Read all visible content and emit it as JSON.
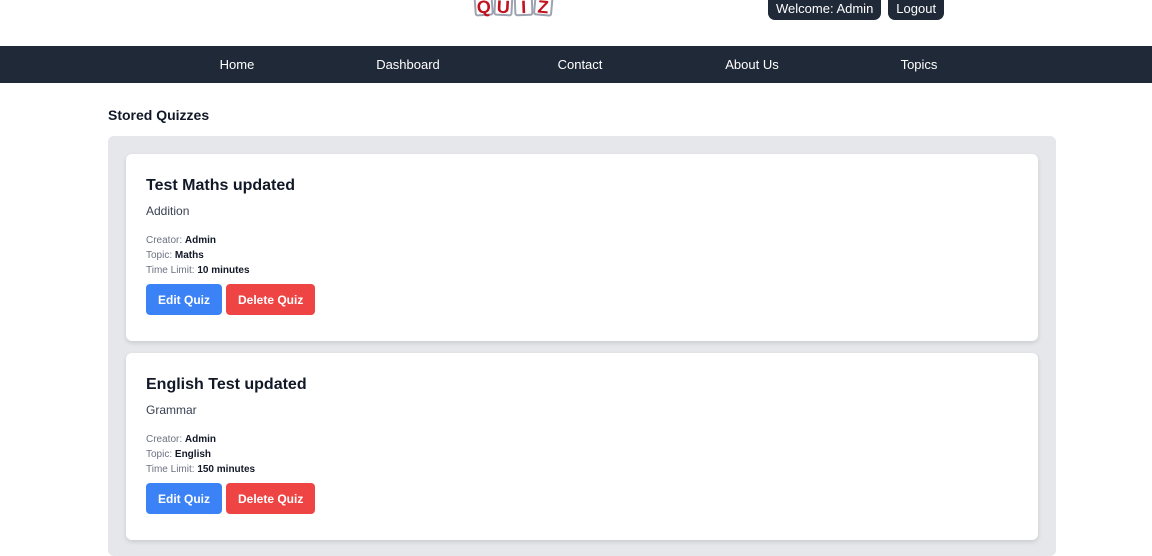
{
  "header": {
    "logo_letters": [
      "Q",
      "U",
      "I",
      "Z"
    ],
    "welcome": "Welcome: Admin",
    "logout_label": "Logout"
  },
  "nav": {
    "items": [
      {
        "label": "Home"
      },
      {
        "label": "Dashboard"
      },
      {
        "label": "Contact"
      },
      {
        "label": "About Us"
      },
      {
        "label": "Topics"
      }
    ]
  },
  "main": {
    "title": "Stored Quizzes",
    "quizzes": [
      {
        "title": "Test Maths updated",
        "description": "Addition",
        "creator_label": "Creator:",
        "creator": "Admin",
        "topic_label": "Topic:",
        "topic": "Maths",
        "time_label": "Time Limit:",
        "time_limit": "10 minutes",
        "edit_label": "Edit Quiz",
        "delete_label": "Delete Quiz"
      },
      {
        "title": "English Test updated",
        "description": "Grammar",
        "creator_label": "Creator:",
        "creator": "Admin",
        "topic_label": "Topic:",
        "topic": "English",
        "time_label": "Time Limit:",
        "time_limit": "150 minutes",
        "edit_label": "Edit Quiz",
        "delete_label": "Delete Quiz"
      }
    ]
  },
  "colors": {
    "navbar": "#1f2937",
    "edit_button": "#3b82f6",
    "delete_button": "#ef4444",
    "container": "#e5e7eb",
    "logo_letter": "#c1121f"
  }
}
